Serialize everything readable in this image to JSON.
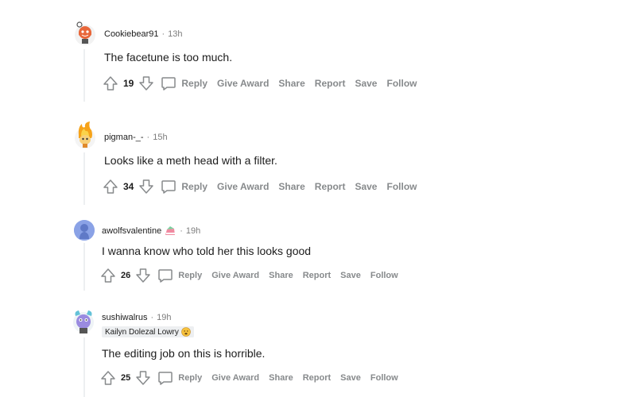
{
  "colors": {
    "text": "#1c1c1c",
    "muted": "#7c7c7c",
    "action": "#878a8c",
    "thread": "#edeff1"
  },
  "comments": [
    {
      "username": "Cookiebear91",
      "sep": "·",
      "time": "13h",
      "body": "The facetune is too much.",
      "score": "19",
      "actions": {
        "reply": "Reply",
        "award": "Give Award",
        "share": "Share",
        "report": "Report",
        "save": "Save",
        "follow": "Follow"
      }
    },
    {
      "username": "pigman-_-",
      "sep": "·",
      "time": "15h",
      "body": "Looks like a meth head with a filter.",
      "score": "34",
      "actions": {
        "reply": "Reply",
        "award": "Give Award",
        "share": "Share",
        "report": "Report",
        "save": "Save",
        "follow": "Follow"
      }
    },
    {
      "username": "awolfsvalentine",
      "sep": "·",
      "time": "19h",
      "body": "I wanna know who told her this looks good",
      "score": "26",
      "actions": {
        "reply": "Reply",
        "award": "Give Award",
        "share": "Share",
        "report": "Report",
        "save": "Save",
        "follow": "Follow"
      }
    },
    {
      "username": "sushiwalrus",
      "sep": "·",
      "time": "19h",
      "flair": "Kailyn Dolezal Lowry",
      "body": "The editing job on this is horrible.",
      "score": "25",
      "actions": {
        "reply": "Reply",
        "award": "Give Award",
        "share": "Share",
        "report": "Report",
        "save": "Save",
        "follow": "Follow"
      }
    }
  ]
}
